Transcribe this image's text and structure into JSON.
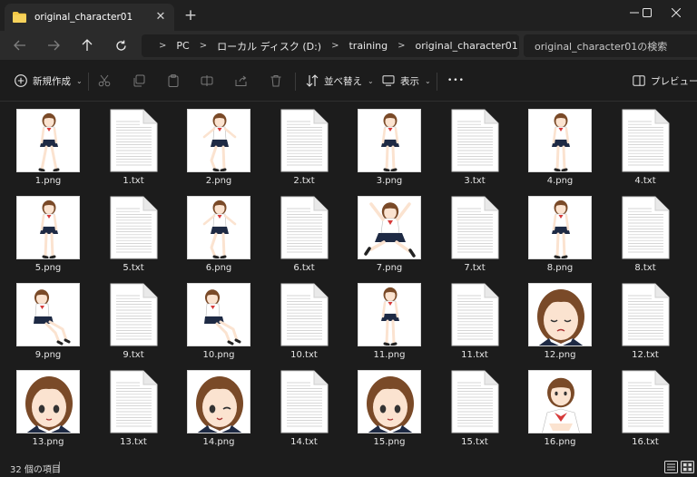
{
  "window": {
    "tab_title": "original_character01",
    "tab_close_glyph": "✕",
    "new_tab_glyph": "+"
  },
  "address": {
    "segments": [
      "PC",
      "ローカル ディスク (D:)",
      "training",
      "original_character01"
    ],
    "search_placeholder": "original_character01の検索"
  },
  "toolbar": {
    "new_label": "新規作成",
    "sort_label": "並べ替え",
    "view_label": "表示",
    "more_label": "•••",
    "preview_label": "プレビュー"
  },
  "files": [
    {
      "name": "1.png",
      "type": "png",
      "pose": "pose-a"
    },
    {
      "name": "1.txt",
      "type": "txt"
    },
    {
      "name": "2.png",
      "type": "png",
      "pose": "pose-b"
    },
    {
      "name": "2.txt",
      "type": "txt"
    },
    {
      "name": "3.png",
      "type": "png",
      "pose": "pose-c"
    },
    {
      "name": "3.txt",
      "type": "txt"
    },
    {
      "name": "4.png",
      "type": "png",
      "pose": "pose-d"
    },
    {
      "name": "4.txt",
      "type": "txt"
    },
    {
      "name": "5.png",
      "type": "png",
      "pose": "pose-c"
    },
    {
      "name": "5.txt",
      "type": "txt"
    },
    {
      "name": "6.png",
      "type": "png",
      "pose": "pose-b"
    },
    {
      "name": "6.txt",
      "type": "txt"
    },
    {
      "name": "7.png",
      "type": "png",
      "pose": "pose-jump"
    },
    {
      "name": "7.txt",
      "type": "txt"
    },
    {
      "name": "8.png",
      "type": "png",
      "pose": "pose-d"
    },
    {
      "name": "8.txt",
      "type": "txt"
    },
    {
      "name": "9.png",
      "type": "png",
      "pose": "pose-sit"
    },
    {
      "name": "9.txt",
      "type": "txt"
    },
    {
      "name": "10.png",
      "type": "png",
      "pose": "pose-sit"
    },
    {
      "name": "10.txt",
      "type": "txt"
    },
    {
      "name": "11.png",
      "type": "png",
      "pose": "pose-c"
    },
    {
      "name": "11.txt",
      "type": "txt"
    },
    {
      "name": "12.png",
      "type": "png",
      "pose": "face-sad"
    },
    {
      "name": "12.txt",
      "type": "txt"
    },
    {
      "name": "13.png",
      "type": "png",
      "pose": "face"
    },
    {
      "name": "13.txt",
      "type": "txt"
    },
    {
      "name": "14.png",
      "type": "png",
      "pose": "face-wink"
    },
    {
      "name": "14.txt",
      "type": "txt"
    },
    {
      "name": "15.png",
      "type": "png",
      "pose": "face"
    },
    {
      "name": "15.txt",
      "type": "txt"
    },
    {
      "name": "16.png",
      "type": "png",
      "pose": "bust"
    },
    {
      "name": "16.txt",
      "type": "txt"
    }
  ],
  "status": {
    "item_count": "32 個の項目"
  },
  "colors": {
    "window_bg": "#1c1c1c",
    "accent_folder": "#f2c744",
    "uniform_red": "#d63a3a",
    "uniform_navy": "#1e2a44",
    "hair": "#7a4a28"
  }
}
